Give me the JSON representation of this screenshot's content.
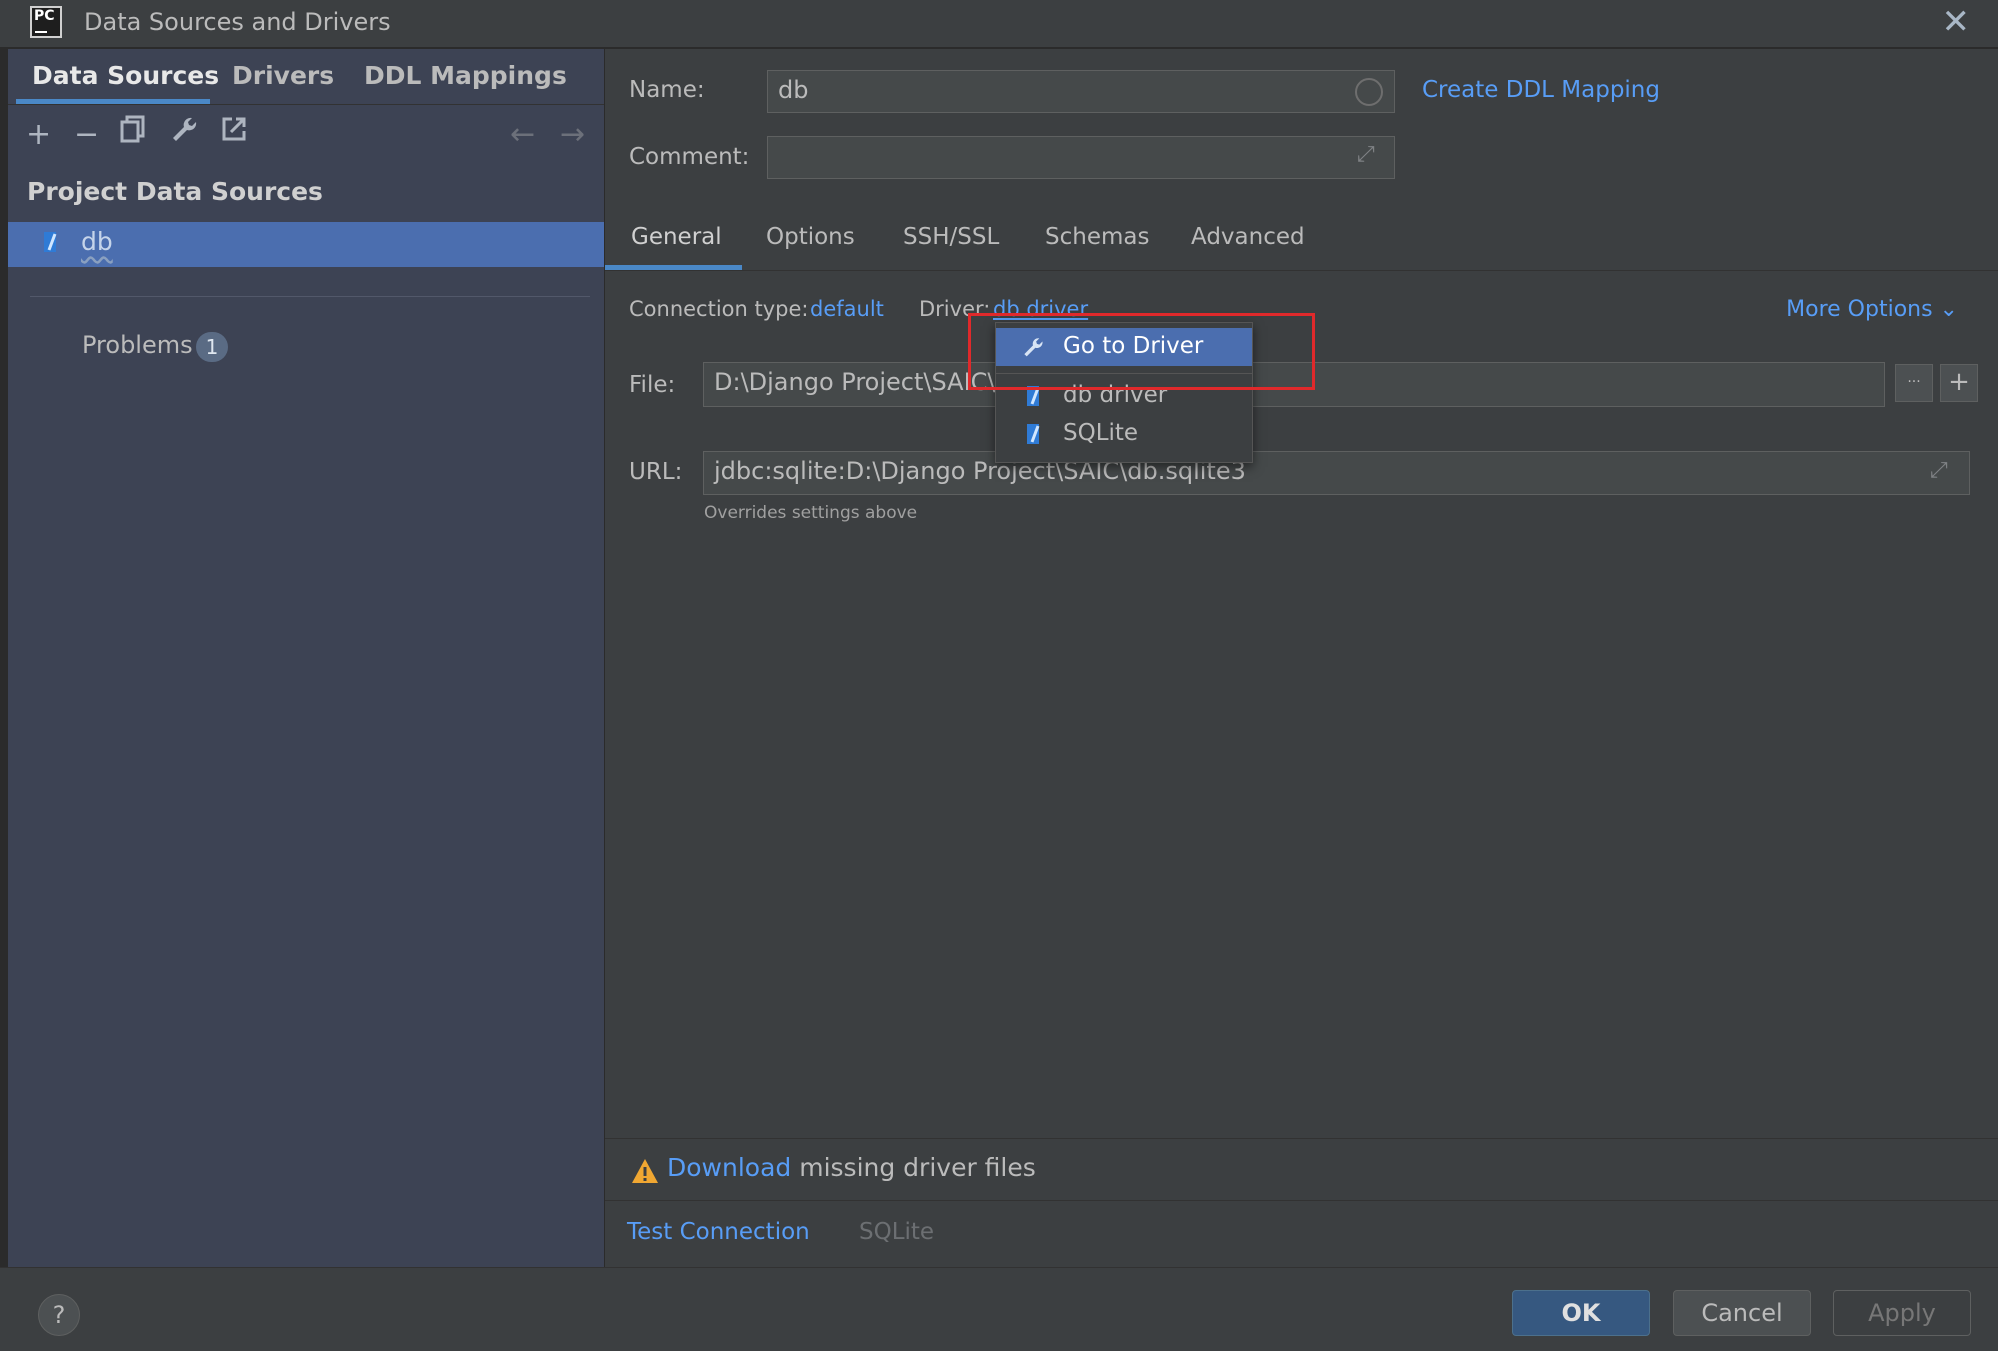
{
  "window": {
    "title": "Data Sources and Drivers",
    "logo_text": "PC"
  },
  "left": {
    "tabs": [
      {
        "label": "Data Sources"
      },
      {
        "label": "Drivers"
      },
      {
        "label": "DDL Mappings"
      }
    ],
    "section_title": "Project Data Sources",
    "data_source_item": "db",
    "problems_label": "Problems",
    "problems_count": "1"
  },
  "right": {
    "name_label": "Name:",
    "name_value": "db",
    "create_ddl_link": "Create DDL Mapping",
    "comment_label": "Comment:",
    "comment_value": "",
    "tabs": [
      {
        "label": "General"
      },
      {
        "label": "Options"
      },
      {
        "label": "SSH/SSL"
      },
      {
        "label": "Schemas"
      },
      {
        "label": "Advanced"
      }
    ],
    "connection_type_label": "Connection type:",
    "connection_type_value": "default",
    "driver_label": "Driver:",
    "driver_value": "db driver",
    "more_options": "More Options",
    "file_label": "File:",
    "file_value": "D:\\Django Project\\SAIC\\d",
    "file_browse": "···",
    "file_add": "+",
    "url_label": "URL:",
    "url_value": "jdbc:sqlite:D:\\Django Project\\SAIC\\db.sqlite3",
    "url_hint": "Overrides settings above",
    "warning_link": "Download",
    "warning_text": " missing driver files",
    "test_connection": "Test Connection",
    "driver_display": "SQLite"
  },
  "popup": {
    "items": [
      {
        "label": "Go to Driver"
      },
      {
        "label": "db driver"
      },
      {
        "label": "SQLite"
      }
    ]
  },
  "footer": {
    "help": "?",
    "ok": "OK",
    "cancel": "Cancel",
    "apply": "Apply"
  },
  "colors": {
    "accent": "#4b6eaf",
    "link": "#589df6",
    "highlight": "#e0292b",
    "warning": "#f0a732"
  }
}
